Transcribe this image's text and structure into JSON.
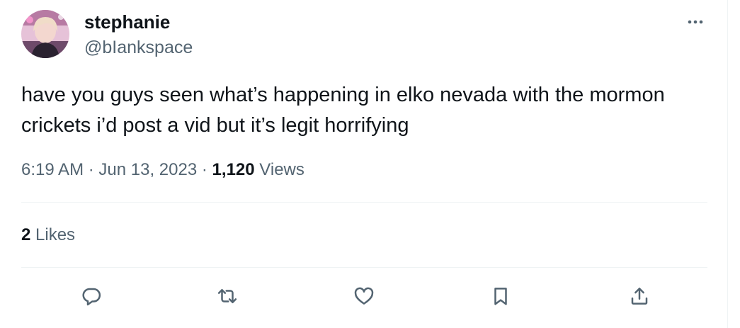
{
  "tweet": {
    "author": {
      "display_name": "stephanie",
      "handle": "@bIankspace"
    },
    "text": "have you guys seen what’s happening in elko nevada with the mormon\ncrickets i’d post a vid but it’s legit horrifying",
    "time": "6:19 AM",
    "date": "Jun 13, 2023",
    "separator": "·",
    "views_count": "1,120",
    "views_label": "Views",
    "likes_count": "2",
    "likes_label": "Likes"
  },
  "actions": [
    {
      "name": "reply",
      "icon": "reply-icon"
    },
    {
      "name": "retweet",
      "icon": "retweet-icon"
    },
    {
      "name": "like",
      "icon": "heart-icon"
    },
    {
      "name": "bookmark",
      "icon": "bookmark-icon"
    },
    {
      "name": "share",
      "icon": "share-icon"
    }
  ],
  "colors": {
    "text_primary": "#0f1419",
    "text_secondary": "#536471",
    "divider": "#eff3f4",
    "avatar_bg": "#d9a9c8"
  }
}
